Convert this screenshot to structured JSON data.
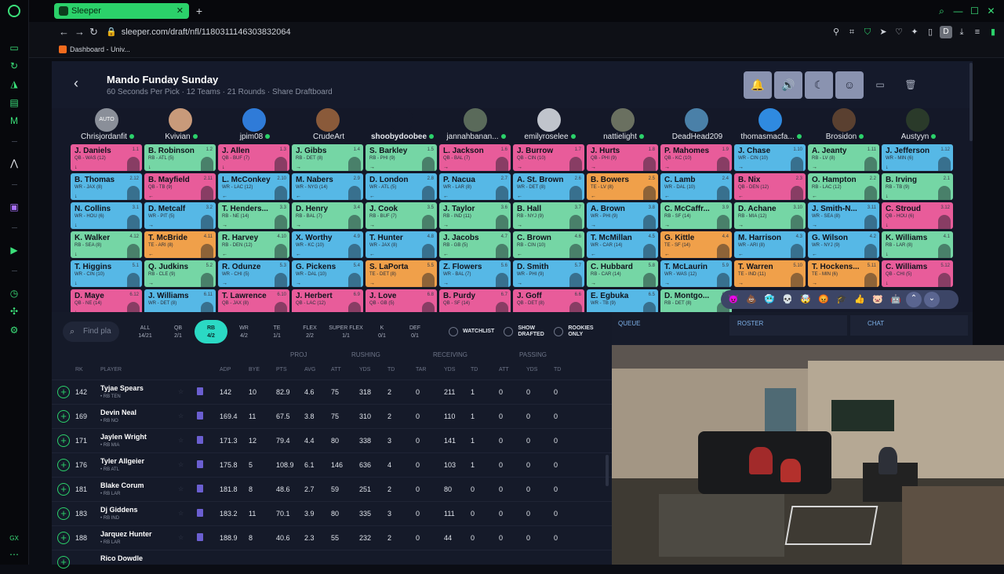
{
  "browser": {
    "tab_title": "Sleeper",
    "url": "sleeper.com/draft/nfl/1180311146303832064",
    "bookmark": "Dashboard - Univ..."
  },
  "draft": {
    "title": "Mando Funday Sunday",
    "subtitle": "60 Seconds Per Pick · 12 Teams · 21 Rounds · Share Draftboard"
  },
  "teams": [
    {
      "name": "Chrisjordanfit",
      "avatar": "AUTO",
      "color": "#8a8f99",
      "online": true,
      "bold": false
    },
    {
      "name": "Kvivian",
      "avatar": "",
      "color": "#c89a7a",
      "online": true,
      "bold": false
    },
    {
      "name": "jpim08",
      "avatar": "",
      "color": "#2f7bd8",
      "online": true,
      "bold": false
    },
    {
      "name": "CrudeArt",
      "avatar": "",
      "color": "#8a5a3a",
      "online": false,
      "bold": false
    },
    {
      "name": "shoobydoobee",
      "avatar": "",
      "color": "#141828",
      "online": true,
      "bold": true
    },
    {
      "name": "jannahbanan...",
      "avatar": "",
      "color": "#5a6a5a",
      "online": true,
      "bold": false
    },
    {
      "name": "emilyroselee",
      "avatar": "",
      "color": "#c0c4cc",
      "online": true,
      "bold": false
    },
    {
      "name": "nattielight",
      "avatar": "",
      "color": "#6a7060",
      "online": true,
      "bold": false
    },
    {
      "name": "DeadHead209",
      "avatar": "",
      "color": "#4a80a8",
      "online": false,
      "bold": false
    },
    {
      "name": "thomasmacfa...",
      "avatar": "",
      "color": "#2f8ae0",
      "online": true,
      "bold": false
    },
    {
      "name": "Brosidon",
      "avatar": "",
      "color": "#5a4030",
      "online": true,
      "bold": false
    },
    {
      "name": "Austyyn",
      "avatar": "",
      "color": "#2a3a2a",
      "online": true,
      "bold": false
    }
  ],
  "board": [
    [
      [
        "J. Daniels",
        "QB - WAS (12)",
        "1.1",
        "qb",
        "↓"
      ],
      [
        "B. Robinson",
        "RB - ATL (5)",
        "1.2",
        "rb",
        "↓"
      ],
      [
        "J. Allen",
        "QB - BUF (7)",
        "1.3",
        "qb",
        "↓"
      ],
      [
        "J. Gibbs",
        "RB - DET (8)",
        "1.4",
        "rb",
        "→"
      ],
      [
        "S. Barkley",
        "RB - PHI (9)",
        "1.5",
        "rb",
        "→"
      ],
      [
        "L. Jackson",
        "QB - BAL (7)",
        "1.6",
        "qb",
        "→"
      ],
      [
        "J. Burrow",
        "QB - CIN (10)",
        "1.7",
        "qb",
        "→"
      ],
      [
        "J. Hurts",
        "QB - PHI (9)",
        "1.8",
        "qb",
        "→"
      ],
      [
        "P. Mahomes",
        "QB - KC (10)",
        "1.9",
        "qb",
        "→"
      ],
      [
        "J. Chase",
        "WR - CIN (10)",
        "1.10",
        "wr",
        "→"
      ],
      [
        "A. Jeanty",
        "RB - LV (8)",
        "1.11",
        "rb",
        "→"
      ],
      [
        "J. Jefferson",
        "WR - MIN (6)",
        "1.12",
        "wr",
        "↓"
      ]
    ],
    [
      [
        "B. Thomas",
        "WR - JAX (8)",
        "2.12",
        "wr",
        "↓"
      ],
      [
        "B. Mayfield",
        "QB - TB (9)",
        "2.11",
        "qb",
        "←"
      ],
      [
        "L. McConkey",
        "WR - LAC (12)",
        "2.10",
        "wr",
        "←"
      ],
      [
        "M. Nabers",
        "WR - NYG (14)",
        "2.9",
        "wr",
        "←"
      ],
      [
        "D. London",
        "WR - ATL (5)",
        "2.8",
        "wr",
        "←"
      ],
      [
        "P. Nacua",
        "WR - LAR (8)",
        "2.7",
        "wr",
        "←"
      ],
      [
        "A. St. Brown",
        "WR - DET (8)",
        "2.6",
        "wr",
        "←"
      ],
      [
        "B. Bowers",
        "TE - LV (8)",
        "2.5",
        "te",
        "←"
      ],
      [
        "C. Lamb",
        "WR - DAL (10)",
        "2.4",
        "wr",
        "←"
      ],
      [
        "B. Nix",
        "QB - DEN (12)",
        "2.3",
        "qb",
        "←"
      ],
      [
        "O. Hampton",
        "RB - LAC (12)",
        "2.2",
        "rb",
        "←"
      ],
      [
        "B. Irving",
        "RB - TB (9)",
        "2.1",
        "rb",
        "↓"
      ]
    ],
    [
      [
        "N. Collins",
        "WR - HOU (6)",
        "3.1",
        "wr",
        "↓"
      ],
      [
        "D. Metcalf",
        "WR - PIT (5)",
        "3.2",
        "wr",
        "→"
      ],
      [
        "T. Henders...",
        "RB - NE (14)",
        "3.3",
        "rb",
        "→"
      ],
      [
        "D. Henry",
        "RB - BAL (7)",
        "3.4",
        "rb",
        "→"
      ],
      [
        "J. Cook",
        "RB - BUF (7)",
        "3.5",
        "rb",
        "→"
      ],
      [
        "J. Taylor",
        "RB - IND (11)",
        "3.6",
        "rb",
        "→"
      ],
      [
        "B. Hall",
        "RB - NYJ (9)",
        "3.7",
        "rb",
        "→"
      ],
      [
        "A. Brown",
        "WR - PHI (9)",
        "3.8",
        "wr",
        "→"
      ],
      [
        "C. McCaffr...",
        "RB - SF (14)",
        "3.9",
        "rb",
        "→"
      ],
      [
        "D. Achane",
        "RB - MIA (12)",
        "3.10",
        "rb",
        "→"
      ],
      [
        "J. Smith-N...",
        "WR - SEA (8)",
        "3.11",
        "wr",
        "→"
      ],
      [
        "C. Stroud",
        "QB - HOU (6)",
        "3.12",
        "qb",
        "↓"
      ]
    ],
    [
      [
        "K. Walker",
        "RB - SEA (8)",
        "4.12",
        "rb",
        "↓"
      ],
      [
        "T. McBride",
        "TE - ARI (8)",
        "4.11",
        "te",
        "←"
      ],
      [
        "R. Harvey",
        "RB - DEN (12)",
        "4.10",
        "rb",
        "←"
      ],
      [
        "X. Worthy",
        "WR - KC (10)",
        "4.9",
        "wr",
        "←"
      ],
      [
        "T. Hunter",
        "WR - JAX (8)",
        "4.8",
        "wr",
        "←"
      ],
      [
        "J. Jacobs",
        "RB - GB (5)",
        "4.7",
        "rb",
        "←"
      ],
      [
        "C. Brown",
        "RB - CIN (10)",
        "4.6",
        "rb",
        "←"
      ],
      [
        "T. McMillan",
        "WR - CAR (14)",
        "4.5",
        "wr",
        "←"
      ],
      [
        "G. Kittle",
        "TE - SF (14)",
        "4.4",
        "te",
        "←"
      ],
      [
        "M. Harrison",
        "WR - ARI (8)",
        "4.3",
        "wr",
        "←"
      ],
      [
        "G. Wilson",
        "WR - NYJ (9)",
        "4.2",
        "wr",
        "←"
      ],
      [
        "K. Williams",
        "RB - LAR (8)",
        "4.1",
        "rb",
        "↓"
      ]
    ],
    [
      [
        "T. Higgins",
        "WR - CIN (10)",
        "5.1",
        "wr",
        "↓"
      ],
      [
        "Q. Judkins",
        "RB - CLE (9)",
        "5.2",
        "rb",
        "→"
      ],
      [
        "R. Odunze",
        "WR - CHI (5)",
        "5.3",
        "wr",
        "→"
      ],
      [
        "G. Pickens",
        "WR - DAL (10)",
        "5.4",
        "wr",
        "→"
      ],
      [
        "S. LaPorta",
        "TE - DET (8)",
        "5.5",
        "te",
        "→"
      ],
      [
        "Z. Flowers",
        "WR - BAL (7)",
        "5.6",
        "wr",
        "→"
      ],
      [
        "D. Smith",
        "WR - PHI (9)",
        "5.7",
        "wr",
        "→"
      ],
      [
        "C. Hubbard",
        "RB - CAR (14)",
        "5.8",
        "rb",
        "→"
      ],
      [
        "T. McLaurin",
        "WR - WAS (12)",
        "5.9",
        "wr",
        "→"
      ],
      [
        "T. Warren",
        "TE - IND (11)",
        "5.10",
        "te",
        "→"
      ],
      [
        "T. Hockens...",
        "TE - MIN (6)",
        "5.11",
        "te",
        "→"
      ],
      [
        "C. Williams",
        "QB - CHI (5)",
        "5.12",
        "qb",
        "↓"
      ]
    ],
    [
      [
        "D. Maye",
        "QB - NE (14)",
        "6.12",
        "qb",
        "↓"
      ],
      [
        "J. Williams",
        "WR - DET (8)",
        "6.11",
        "wr",
        "←"
      ],
      [
        "T. Lawrence",
        "QB - JAX (8)",
        "6.10",
        "qb",
        "←"
      ],
      [
        "J. Herbert",
        "QB - LAC (12)",
        "6.9",
        "qb",
        "←"
      ],
      [
        "J. Love",
        "QB - GB (5)",
        "6.8",
        "qb",
        "←"
      ],
      [
        "B. Purdy",
        "QB - SF (14)",
        "6.7",
        "qb",
        "←"
      ],
      [
        "J. Goff",
        "QB - DET (8)",
        "6.6",
        "qb",
        "←"
      ],
      [
        "E. Egbuka",
        "WR - TB (9)",
        "6.5",
        "wr",
        "←"
      ],
      [
        "D. Montgo...",
        "RB - DET (8)",
        "6.4",
        "rb",
        "←"
      ],
      [
        "",
        "",
        "",
        "rb",
        ""
      ],
      [
        "",
        "",
        "",
        "rb",
        ""
      ],
      [
        "",
        "",
        "",
        "rb",
        ""
      ]
    ]
  ],
  "emoji_bar": [
    "😈",
    "💩",
    "🥶",
    "💀",
    "🤯",
    "😡",
    "🎓",
    "👍",
    "🐷",
    "🤖"
  ],
  "filters": {
    "search_placeholder": "Find pla",
    "positions": [
      {
        "label": "ALL",
        "count": "14/21",
        "selected": false
      },
      {
        "label": "QB",
        "count": "2/1",
        "selected": false
      },
      {
        "label": "RB",
        "count": "4/2",
        "selected": true
      },
      {
        "label": "WR",
        "count": "4/2",
        "selected": false
      },
      {
        "label": "TE",
        "count": "1/1",
        "selected": false
      },
      {
        "label": "FLEX",
        "count": "2/2",
        "selected": false
      },
      {
        "label": "SUPER FLEX",
        "count": "1/1",
        "selected": false
      },
      {
        "label": "K",
        "count": "0/1",
        "selected": false
      },
      {
        "label": "DEF",
        "count": "0/1",
        "selected": false
      }
    ],
    "watchlist": "WATCHLIST",
    "show_drafted": "SHOW DRAFTED",
    "rookies_only": "ROOKIES ONLY"
  },
  "table": {
    "groups": {
      "proj": "PROJ",
      "rushing": "RUSHING",
      "receiving": "RECEIVING",
      "passing": "PASSING"
    },
    "columns": {
      "rk": "RK",
      "player": "PLAYER",
      "adp": "ADP",
      "bye": "BYE",
      "pts": "PTS",
      "avg": "AVG",
      "att": "ATT",
      "yds": "YDS",
      "td": "TD",
      "tar": "TAR",
      "ryds": "YDS",
      "rtd": "TD",
      "patt": "ATT",
      "pyds": "YDS",
      "ptd": "TD"
    },
    "rows": [
      {
        "rk": "142",
        "name": "Tyjae Spears",
        "sub": "• RB  TEN",
        "adp": "142",
        "bye": "10",
        "pts": "82.9",
        "avg": "4.6",
        "att": "75",
        "yds": "318",
        "td": "2",
        "tar": "0",
        "ryds": "211",
        "rtd": "1",
        "patt": "0",
        "pyds": "0",
        "ptd": "0"
      },
      {
        "rk": "169",
        "name": "Devin Neal",
        "sub": "• RB  NO",
        "adp": "169.4",
        "bye": "11",
        "pts": "67.5",
        "avg": "3.8",
        "att": "75",
        "yds": "310",
        "td": "2",
        "tar": "0",
        "ryds": "110",
        "rtd": "1",
        "patt": "0",
        "pyds": "0",
        "ptd": "0"
      },
      {
        "rk": "171",
        "name": "Jaylen Wright",
        "sub": "• RB  MIA",
        "adp": "171.3",
        "bye": "12",
        "pts": "79.4",
        "avg": "4.4",
        "att": "80",
        "yds": "338",
        "td": "3",
        "tar": "0",
        "ryds": "141",
        "rtd": "1",
        "patt": "0",
        "pyds": "0",
        "ptd": "0"
      },
      {
        "rk": "176",
        "name": "Tyler Allgeier",
        "sub": "• RB  ATL",
        "adp": "175.8",
        "bye": "5",
        "pts": "108.9",
        "avg": "6.1",
        "att": "146",
        "yds": "636",
        "td": "4",
        "tar": "0",
        "ryds": "103",
        "rtd": "1",
        "patt": "0",
        "pyds": "0",
        "ptd": "0"
      },
      {
        "rk": "181",
        "name": "Blake Corum",
        "sub": "• RB  LAR",
        "adp": "181.8",
        "bye": "8",
        "pts": "48.6",
        "avg": "2.7",
        "att": "59",
        "yds": "251",
        "td": "2",
        "tar": "0",
        "ryds": "80",
        "rtd": "0",
        "patt": "0",
        "pyds": "0",
        "ptd": "0"
      },
      {
        "rk": "183",
        "name": "Dj Giddens",
        "sub": "• RB  IND",
        "adp": "183.2",
        "bye": "11",
        "pts": "70.1",
        "avg": "3.9",
        "att": "80",
        "yds": "335",
        "td": "3",
        "tar": "0",
        "ryds": "111",
        "rtd": "0",
        "patt": "0",
        "pyds": "0",
        "ptd": "0"
      },
      {
        "rk": "188",
        "name": "Jarquez Hunter",
        "sub": "• RB  LAR",
        "adp": "188.9",
        "bye": "8",
        "pts": "40.6",
        "avg": "2.3",
        "att": "55",
        "yds": "232",
        "td": "2",
        "tar": "0",
        "ryds": "44",
        "rtd": "0",
        "patt": "0",
        "pyds": "0",
        "ptd": "0"
      },
      {
        "rk": "",
        "name": "Rico Dowdle",
        "sub": "",
        "adp": "",
        "bye": "",
        "pts": "",
        "avg": "",
        "att": "",
        "yds": "",
        "td": "",
        "tar": "",
        "ryds": "",
        "rtd": "",
        "patt": "",
        "pyds": "",
        "ptd": ""
      }
    ]
  },
  "right_tabs": {
    "queue": "QUEUE",
    "roster": "ROSTER",
    "chat": "CHAT"
  }
}
